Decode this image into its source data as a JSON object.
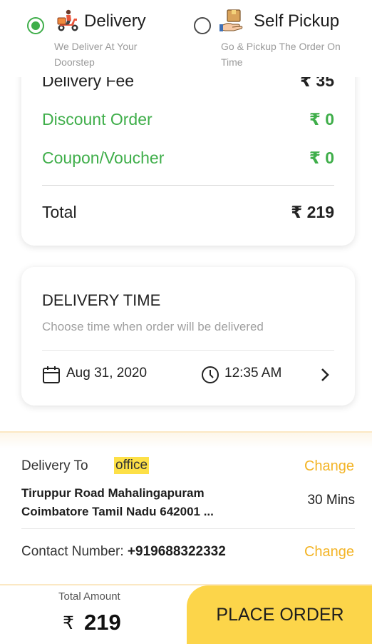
{
  "header": {
    "delivery": {
      "title": "Delivery",
      "desc": "We Deliver At Your Doorstep",
      "selected": true
    },
    "pickup": {
      "title": "Self Pickup",
      "desc": "Go & Pickup The Order On Time",
      "selected": false
    }
  },
  "summary": {
    "delivery_fee_label": "Delivery Fee",
    "delivery_fee_value": "₹ 35",
    "discount_label": "Discount Order",
    "discount_value": "₹ 0",
    "coupon_label": "Coupon/Voucher",
    "coupon_value": "₹ 0",
    "total_label": "Total",
    "total_value": "₹ 219"
  },
  "delivery_time": {
    "title": "DELIVERY TIME",
    "subtitle": "Choose time when order will be delivered",
    "date": "Aug 31, 2020",
    "time": "12:35 AM"
  },
  "address": {
    "label": "Delivery To",
    "tag": "office",
    "change": "Change",
    "line1": "Tiruppur Road Mahalingapuram",
    "line2": "Coimbatore Tamil Nadu 642001 ...",
    "eta": "30 Mins",
    "contact_label": "Contact Number:",
    "contact_number": "+919688322332",
    "contact_change": "Change"
  },
  "footer": {
    "total_label": "Total Amount",
    "currency": "₹",
    "total_amount": "219",
    "place_order": "PLACE ORDER"
  },
  "colors": {
    "green": "#3fae4a",
    "accent": "#fcd54a",
    "change": "#f3b426",
    "tag": "#fde047"
  }
}
